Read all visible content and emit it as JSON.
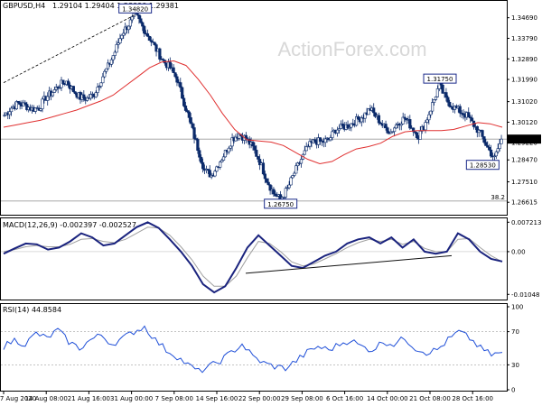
{
  "header": {
    "instrument": "GBPUSD,H4",
    "ohlc": "1.29104 1.29404 1.28990 1.29381"
  },
  "watermark": "ActionForex.com",
  "colors": {
    "candle": "#0b2a6a",
    "ma": "#e03030",
    "macd_main": "#1a237e",
    "macd_signal": "#a0a0a0",
    "rsi": "#1f4fd8",
    "level_line": "#9a9a9a",
    "trendline": "#111111",
    "watermark": "#d8d8d8"
  },
  "chart_data": [
    {
      "type": "candlestick",
      "name": "price",
      "ylim": [
        1.2615,
        1.3515
      ],
      "y_ticks": [
        "1.34690",
        "1.33790",
        "1.32890",
        "1.31990",
        "1.31020",
        "1.30120",
        "1.29220",
        "1.28470",
        "1.27510",
        "1.26615"
      ],
      "x_ticks": [
        "7 Aug 2020",
        "14 Aug 08:00",
        "21 Aug 16:00",
        "31 Aug 00:00",
        "7 Sep 08:00",
        "14 Sep 16:00",
        "22 Sep 00:00",
        "29 Sep 08:00",
        "6 Oct 16:00",
        "14 Oct 00:00",
        "21 Oct 08:00",
        "28 Oct 16:00"
      ],
      "close_path": [
        1.3043,
        1.3075,
        1.3095,
        1.3085,
        1.307,
        1.3075,
        1.312,
        1.3145,
        1.3175,
        1.319,
        1.315,
        1.312,
        1.3115,
        1.3135,
        1.32,
        1.3255,
        1.332,
        1.34,
        1.344,
        1.3482,
        1.343,
        1.338,
        1.333,
        1.328,
        1.325,
        1.32,
        1.31,
        1.3,
        1.29,
        1.28,
        1.278,
        1.283,
        1.288,
        1.294,
        1.296,
        1.294,
        1.29,
        1.284,
        1.276,
        1.27,
        1.2675,
        1.272,
        1.279,
        1.285,
        1.2905,
        1.293,
        1.2925,
        1.2935,
        1.298,
        1.299,
        1.3,
        1.302,
        1.304,
        1.307,
        1.303,
        1.299,
        1.297,
        1.301,
        1.303,
        1.299,
        1.295,
        1.301,
        1.309,
        1.3175,
        1.311,
        1.308,
        1.306,
        1.304,
        1.3,
        1.296,
        1.29,
        1.2853,
        1.2938
      ],
      "ma_path": [
        1.299,
        1.3,
        1.301,
        1.302,
        1.3035,
        1.305,
        1.3065,
        1.3085,
        1.3105,
        1.313,
        1.317,
        1.321,
        1.325,
        1.3275,
        1.328,
        1.326,
        1.32,
        1.313,
        1.305,
        1.298,
        1.2935,
        1.293,
        1.2925,
        1.291,
        1.288,
        1.285,
        1.283,
        1.284,
        1.287,
        1.2895,
        1.2905,
        1.292,
        1.295,
        1.297,
        1.2975,
        1.2975,
        1.2975,
        1.298,
        1.2995,
        1.301,
        1.3005,
        1.299
      ],
      "levels": [
        {
          "value": 1.2938,
          "label": "1.29381"
        },
        {
          "value": 1.2667,
          "label": "38.2"
        }
      ],
      "price_tag": "1.29381",
      "annotations": [
        {
          "label": "1.34820",
          "value": 1.3482
        },
        {
          "label": "1.26750",
          "value": 1.2675
        },
        {
          "label": "1.31750",
          "value": 1.3175
        },
        {
          "label": "1.28530",
          "value": 1.2853
        }
      ]
    },
    {
      "type": "line",
      "name": "MACD",
      "title": "MACD(12,26,9) -0.002397 -0.002527",
      "ylim": [
        -0.0113,
        0.0075
      ],
      "y_ticks": [
        "0.007213",
        "0.00",
        "-0.01048"
      ],
      "main_path": [
        -0.0005,
        0.0008,
        0.002,
        0.0018,
        0.0005,
        0.001,
        0.0025,
        0.0045,
        0.0035,
        0.0015,
        0.002,
        0.004,
        0.006,
        0.0072,
        0.0058,
        0.003,
        0.0,
        -0.0035,
        -0.008,
        -0.01,
        -0.0085,
        -0.004,
        0.001,
        0.004,
        0.0015,
        -0.001,
        -0.0035,
        -0.004,
        -0.0025,
        -0.001,
        0.0,
        0.002,
        0.003,
        0.0035,
        0.002,
        0.0035,
        0.001,
        0.003,
        0.0,
        -0.0005,
        0.0,
        0.0045,
        0.003,
        0.0,
        -0.0018,
        -0.0024
      ],
      "signal_path": [
        0.0,
        0.0005,
        0.0012,
        0.0015,
        0.0012,
        0.0012,
        0.0018,
        0.003,
        0.0032,
        0.0025,
        0.0022,
        0.003,
        0.0045,
        0.006,
        0.0058,
        0.004,
        0.0012,
        -0.002,
        -0.006,
        -0.0085,
        -0.0085,
        -0.006,
        -0.0015,
        0.0025,
        0.002,
        0.0,
        -0.0025,
        -0.0035,
        -0.003,
        -0.0018,
        -0.0005,
        0.001,
        0.0022,
        0.003,
        0.0025,
        0.003,
        0.0018,
        0.0025,
        0.0008,
        0.0,
        0.0,
        0.003,
        0.0032,
        0.001,
        -0.001,
        -0.0025
      ],
      "trendline": [
        {
          "value": -0.0053
        },
        {
          "value": -0.001
        }
      ]
    },
    {
      "type": "line",
      "name": "RSI",
      "title": "RSI(14) 44.8584",
      "ylim": [
        0,
        100
      ],
      "y_ticks": [
        "100",
        "70",
        "30",
        "0"
      ],
      "levels": [
        70,
        30
      ],
      "path": [
        52,
        60,
        55,
        68,
        62,
        72,
        58,
        50,
        60,
        66,
        55,
        62,
        70,
        76,
        60,
        48,
        40,
        30,
        22,
        28,
        35,
        45,
        55,
        40,
        32,
        28,
        26,
        35,
        45,
        52,
        48,
        55,
        60,
        52,
        48,
        58,
        55,
        62,
        50,
        45,
        48,
        60,
        70,
        62,
        50,
        42,
        45
      ]
    }
  ]
}
